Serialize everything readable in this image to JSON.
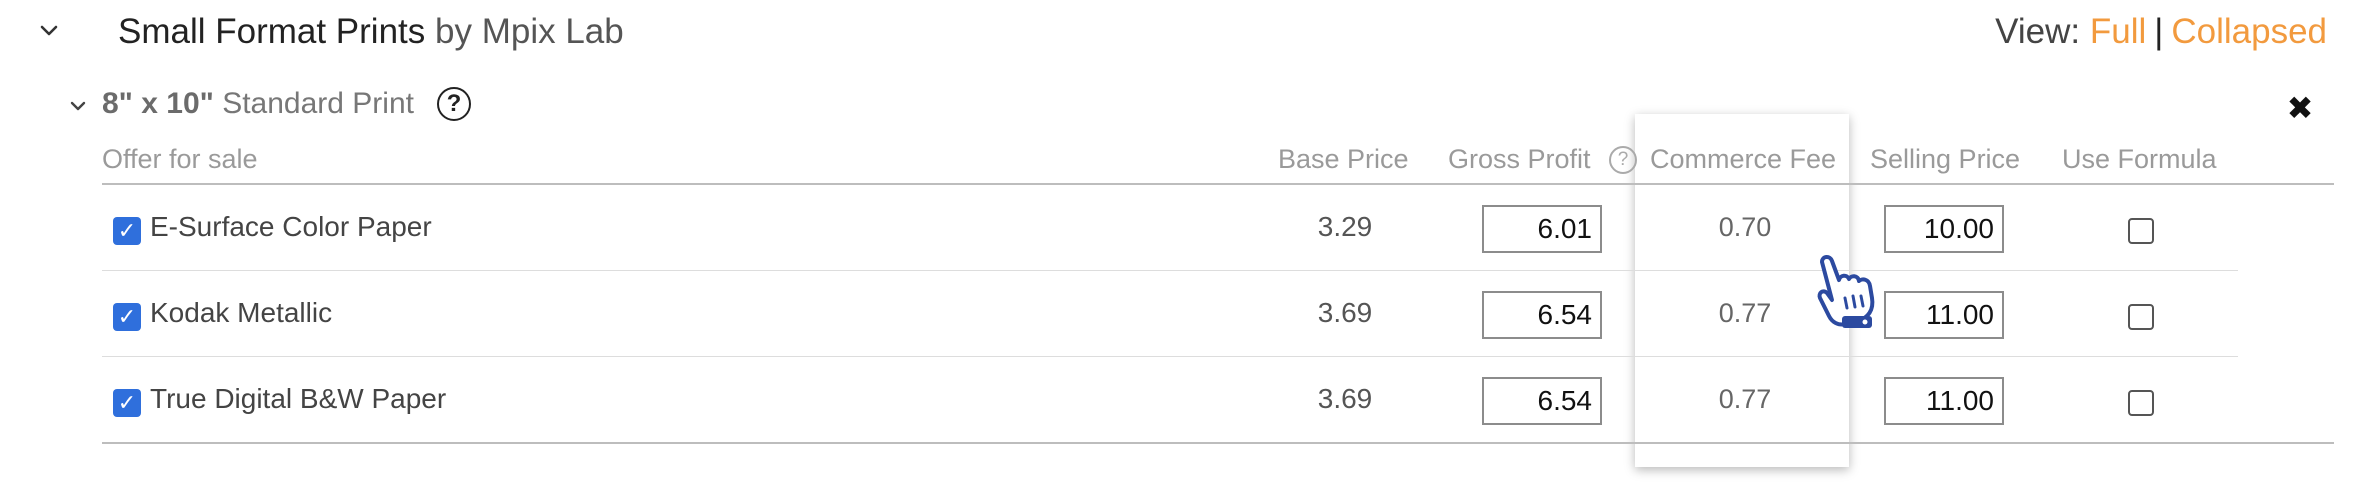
{
  "group": {
    "title_main": "Small Format Prints",
    "title_sub": " by Mpix Lab",
    "chevron_icon": "chevron-down-icon"
  },
  "view": {
    "label": "View: ",
    "full": "Full",
    "separator": "|",
    "collapsed": "Collapsed",
    "link_color": "#f29a3e"
  },
  "subsection": {
    "size": "8\" x 10\"",
    "name": " Standard Print",
    "help": "?",
    "close": "✖"
  },
  "columns": {
    "offer": "Offer for sale",
    "base_price": "Base Price",
    "gross_profit": "Gross Profit",
    "gross_help": "?",
    "commerce_fee": "Commerce Fee",
    "selling_price": "Selling Price",
    "use_formula": "Use Formula"
  },
  "rows": [
    {
      "offer": true,
      "name": "E-Surface Color Paper",
      "base_price": "3.29",
      "gross_profit": "6.01",
      "commerce_fee": "0.70",
      "selling_price": "10.00",
      "use_formula": false
    },
    {
      "offer": true,
      "name": "Kodak Metallic",
      "base_price": "3.69",
      "gross_profit": "6.54",
      "commerce_fee": "0.77",
      "selling_price": "11.00",
      "use_formula": false
    },
    {
      "offer": true,
      "name": "True Digital B&W Paper",
      "base_price": "3.69",
      "gross_profit": "6.54",
      "commerce_fee": "0.77",
      "selling_price": "11.00",
      "use_formula": false
    }
  ],
  "colors": {
    "checkbox_checked": "#2f6fdc",
    "cursor": "#2c4aa0"
  }
}
